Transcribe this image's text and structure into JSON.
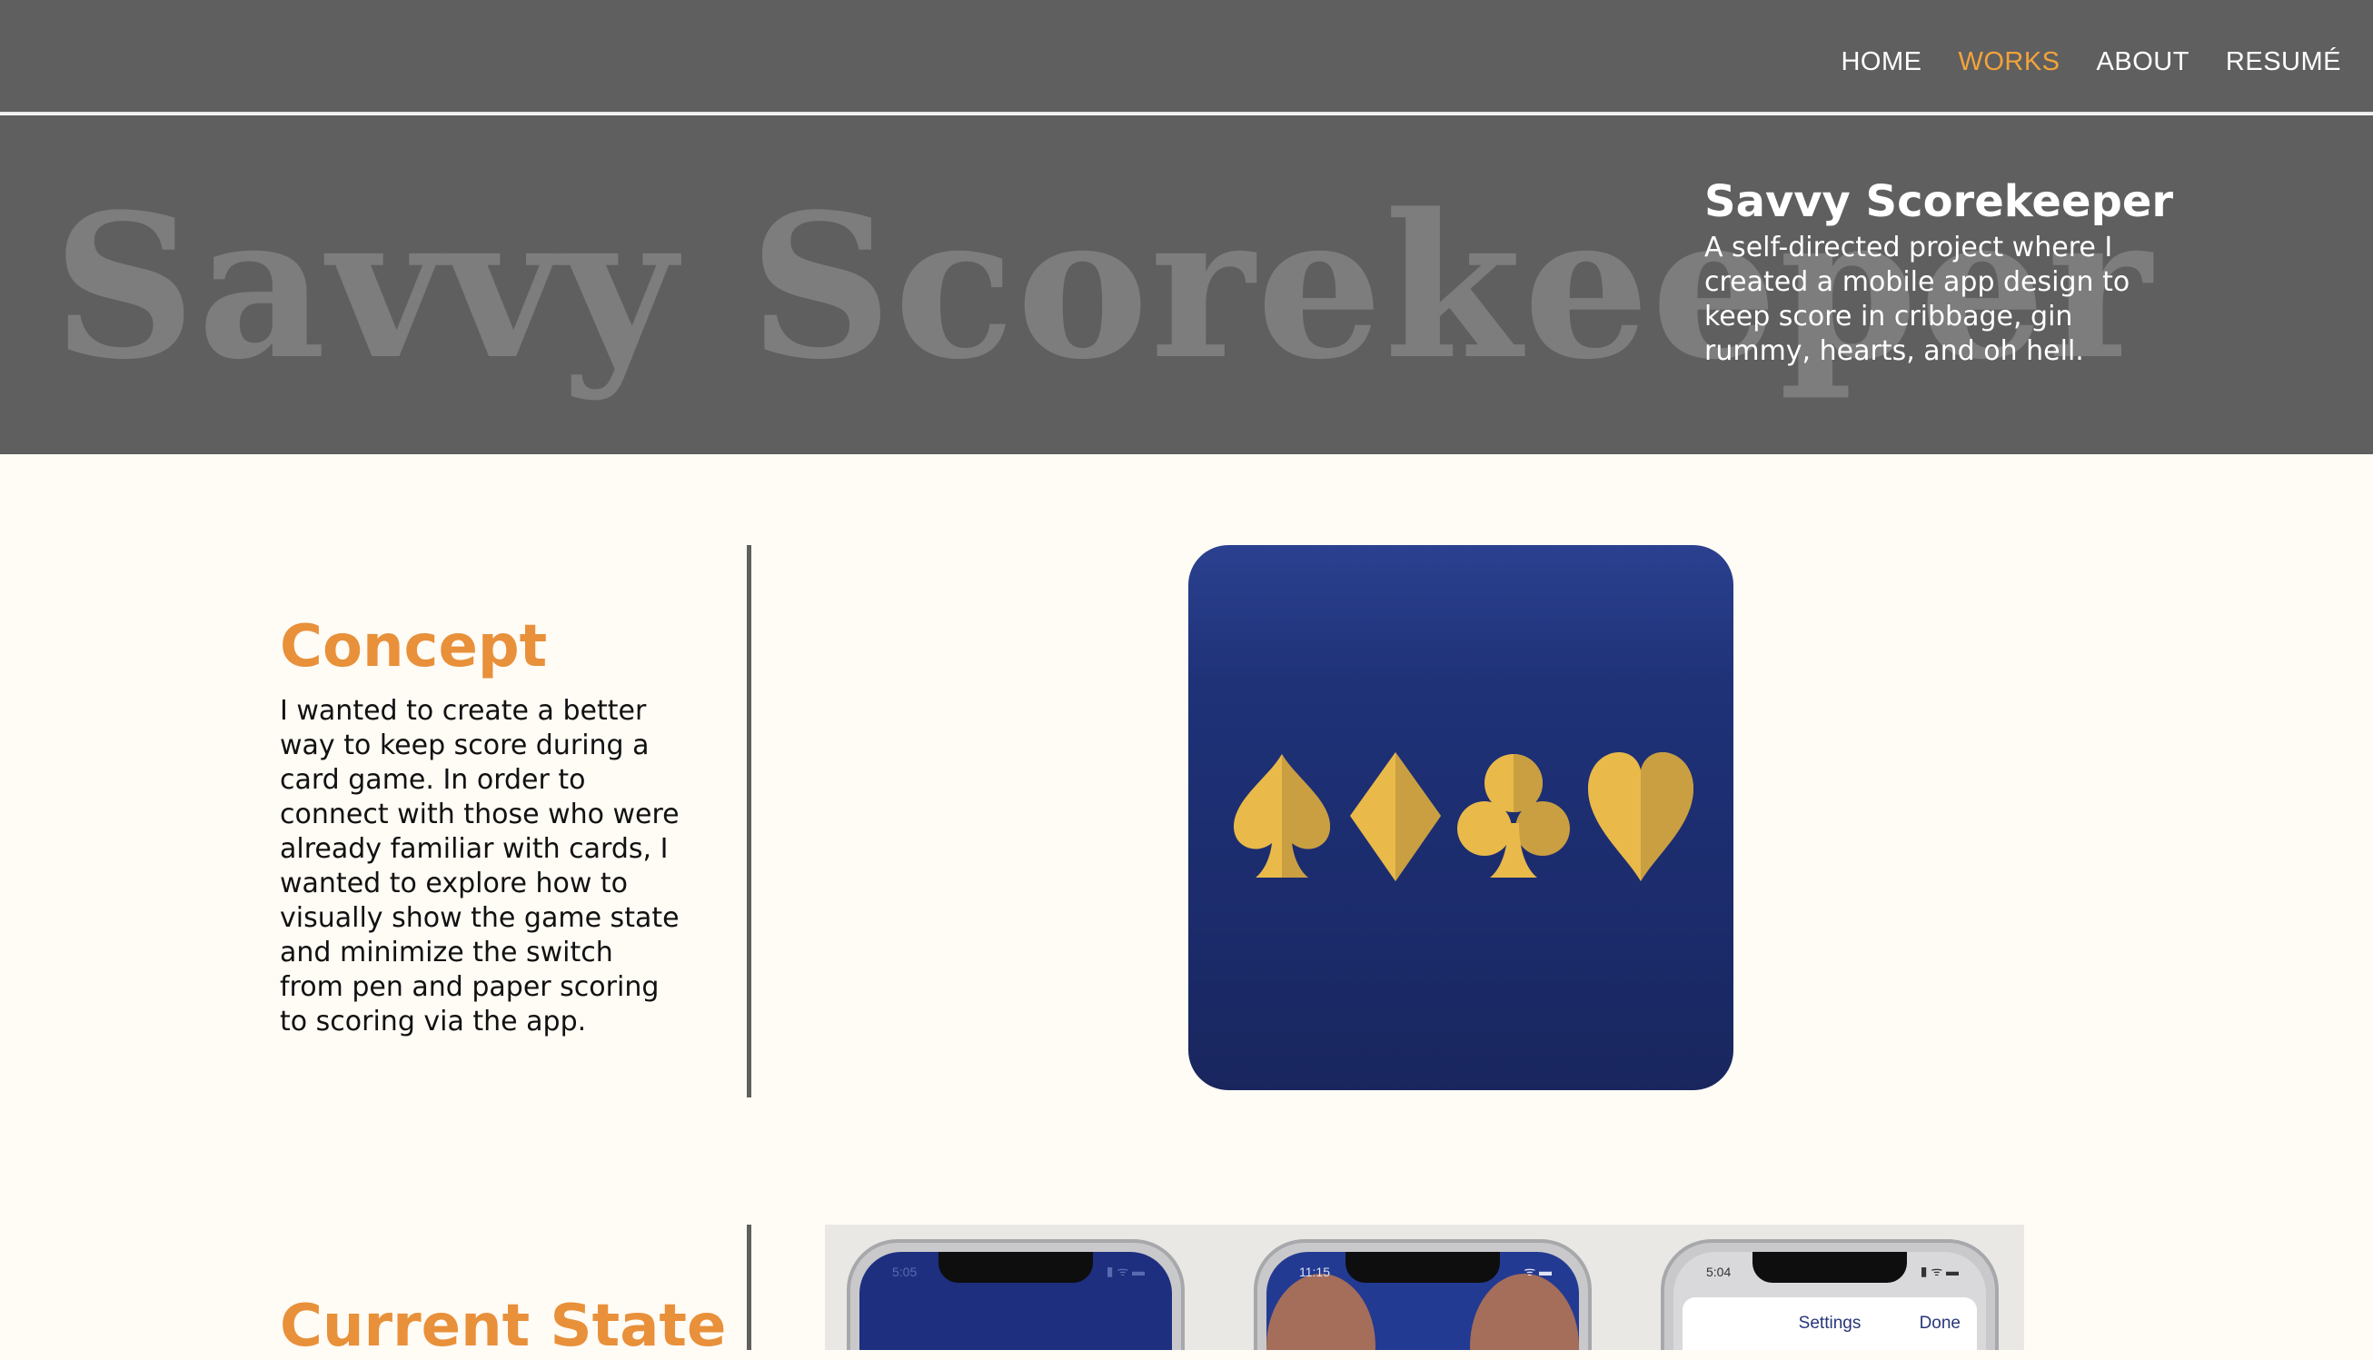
{
  "nav": {
    "items": [
      {
        "label": "HOME",
        "active": false
      },
      {
        "label": "WORKS",
        "active": true
      },
      {
        "label": "ABOUT",
        "active": false
      },
      {
        "label": "RESUMÉ",
        "active": false
      }
    ]
  },
  "hero": {
    "background_title": "Savvy Scorekeeper",
    "title": "Savvy Scorekeeper",
    "description": "A self-directed project where I created a mobile app design to keep score in cribbage, gin rummy, hearts, and oh hell."
  },
  "concept": {
    "title": "Concept",
    "text": "I wanted to create a better way to keep score during a card game. In order to connect with those who were already familiar with cards, I wanted to explore how to visually show the game state and minimize the switch from pen and paper scoring to scoring via the app."
  },
  "current_state": {
    "title": "Current State"
  },
  "app_icon": {
    "suits": [
      "spade-icon",
      "diamond-icon",
      "club-icon",
      "heart-icon"
    ],
    "background_color": "#1f3278",
    "suit_color": "#e9b94a"
  },
  "phones": [
    {
      "time": "5:05",
      "status_icons": "▮ ᯤ ▬"
    },
    {
      "time": "11:15",
      "status_icons": "ᯤ ▬"
    },
    {
      "time": "5:04",
      "status_icons": "▮ ᯤ ▬",
      "sheet_title": "Settings",
      "sheet_done": "Done"
    }
  ],
  "colors": {
    "accent": "#e8903a",
    "nav_active": "#f2a33a",
    "header_bg": "#5f5f5f",
    "page_bg": "#fffbf5"
  }
}
